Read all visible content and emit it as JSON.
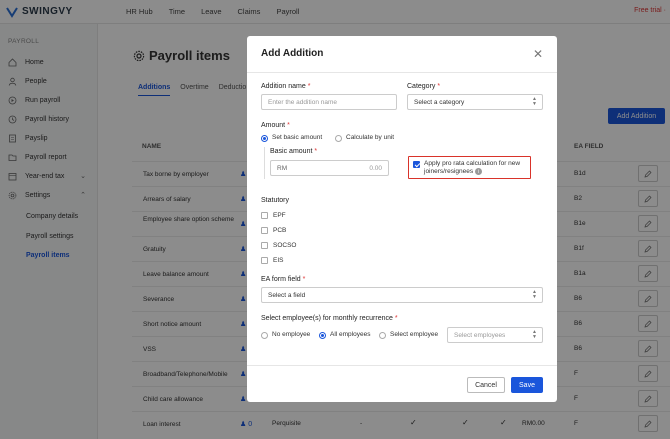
{
  "topbar": {
    "logo_text": "SWINGVY",
    "nav": [
      "HR Hub",
      "Time",
      "Leave",
      "Claims",
      "Payroll"
    ],
    "trial": "Free trial · "
  },
  "sidebar": {
    "heading": "PAYROLL",
    "items": [
      "Home",
      "People",
      "Run payroll",
      "Payroll history",
      "Payslip",
      "Payroll report",
      "Year-end tax",
      "Settings"
    ],
    "sub_items": [
      "Company details",
      "Payroll settings",
      "Payroll items"
    ]
  },
  "main": {
    "title": "Payroll items",
    "tabs": [
      "Additions",
      "Overtime",
      "Deductio"
    ],
    "add_button": "Add Addition",
    "col_name": "NAME",
    "col_ea": "EA FIELD",
    "rows": [
      {
        "name": "Tax borne by employer",
        "users": "",
        "ea": "B1d"
      },
      {
        "name": "Arrears of salary",
        "users": "",
        "ea": "B2"
      },
      {
        "name": "Employee share option scheme",
        "users": "",
        "ea": "B1e"
      },
      {
        "name": "Gratuity",
        "users": "",
        "ea": "B1f"
      },
      {
        "name": "Leave balance amount",
        "users": "",
        "ea": "B1a"
      },
      {
        "name": "Severance",
        "users": "",
        "ea": "B6"
      },
      {
        "name": "Short notice amount",
        "users": "",
        "ea": "B6"
      },
      {
        "name": "VSS",
        "users": "",
        "ea": "B6"
      },
      {
        "name": "Broadband/Telephone/Mobile",
        "users": "",
        "ea": "F"
      },
      {
        "name": "Child care allowance",
        "users": "",
        "ea": "F"
      },
      {
        "name": "Loan interest",
        "users": "0",
        "ea": "F"
      }
    ],
    "last_row_extra": {
      "type": "Perquisite",
      "dash": "-",
      "amount": "RM0.00"
    }
  },
  "modal": {
    "title": "Add Addition",
    "name_label": "Addition name",
    "name_placeholder": "Enter the addition name",
    "category_label": "Category",
    "category_value": "Select a category",
    "amount_label": "Amount",
    "amount_opt1": "Set basic amount",
    "amount_opt2": "Calculate by unit",
    "basic_label": "Basic amount",
    "currency": "RM",
    "basic_value": "0.00",
    "prorata_text": "Apply pro rata calculation for new joiners/resignees",
    "statutory_label": "Statutory",
    "statutory": [
      "EPF",
      "PCB",
      "SOCSO",
      "EIS"
    ],
    "ea_label": "EA form field",
    "ea_value": "Select a field",
    "recurrence_label": "Select employee(s) for monthly recurrence",
    "rec_opt1": "No employee",
    "rec_opt2": "All employees",
    "rec_opt3": "Select employee",
    "rec_select": "Select employees",
    "cancel": "Cancel",
    "save": "Save",
    "required_mark": "*"
  }
}
